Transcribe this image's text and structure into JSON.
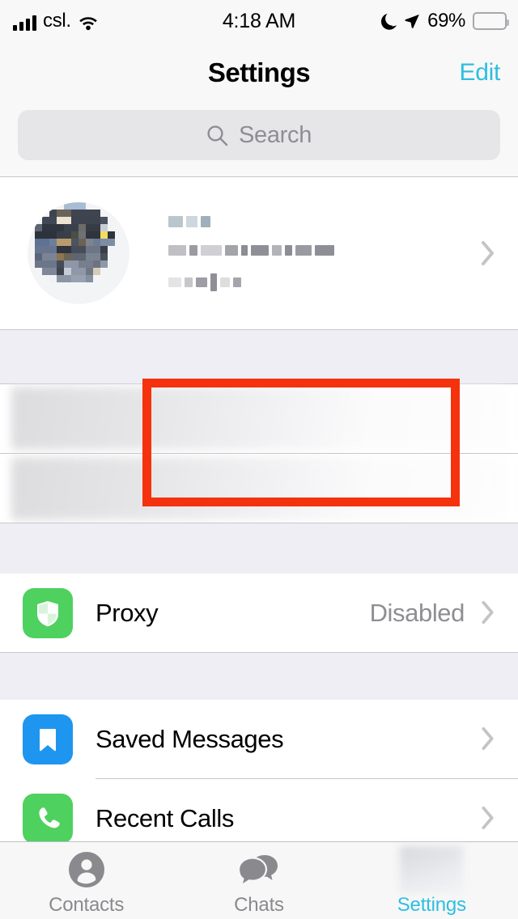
{
  "colors": {
    "accent_cyan": "#2cbfe0",
    "group_bg": "#efeef4",
    "row_bg": "#ffffff",
    "separator": "#c8c7cc",
    "secondary_text": "#8e8e93",
    "annotation_red": "#f4320d",
    "proxy_icon_green": "#4ed15f",
    "saved_icon_blue": "#1e96f0",
    "calls_icon_green": "#4ed15f",
    "battery_yellow": "#fdd734"
  },
  "status_bar": {
    "carrier": "csl.",
    "signal_icon": "cellular-bars-icon",
    "wifi_icon": "wifi-icon",
    "time": "4:18 AM",
    "dnd_icon": "moon-icon",
    "location_icon": "location-arrow-icon",
    "battery_percent": "69%",
    "battery_icon": "battery-icon"
  },
  "nav_bar": {
    "title": "Settings",
    "edit_label": "Edit"
  },
  "search": {
    "placeholder": "Search",
    "icon": "search-icon"
  },
  "profile": {
    "avatar_icon": "user-avatar-pixelated",
    "name_redacted": "",
    "phone_redacted": "",
    "username_redacted": "",
    "chevron_icon": "chevron-right-icon",
    "highlighted": true
  },
  "hidden_rows": [
    {
      "label_redacted": ""
    },
    {
      "label_redacted": ""
    }
  ],
  "settings_groups": [
    {
      "rows": [
        {
          "label": "Proxy",
          "value": "Disabled",
          "icon": "shield-icon",
          "icon_color": "#4ed15f",
          "chevron_icon": "chevron-right-icon"
        }
      ]
    },
    {
      "rows": [
        {
          "label": "Saved Messages",
          "value": "",
          "icon": "bookmark-icon",
          "icon_color": "#1e96f0",
          "chevron_icon": "chevron-right-icon"
        },
        {
          "label": "Recent Calls",
          "value": "",
          "icon": "phone-icon",
          "icon_color": "#4ed15f",
          "chevron_icon": "chevron-right-icon"
        }
      ]
    }
  ],
  "tab_bar": {
    "tabs": [
      {
        "label": "Contacts",
        "icon": "person-circle-icon",
        "active": false
      },
      {
        "label": "Chats",
        "icon": "chat-bubbles-icon",
        "active": false
      },
      {
        "label": "Settings",
        "icon": "gear-icon-blurred",
        "active": true
      }
    ]
  }
}
